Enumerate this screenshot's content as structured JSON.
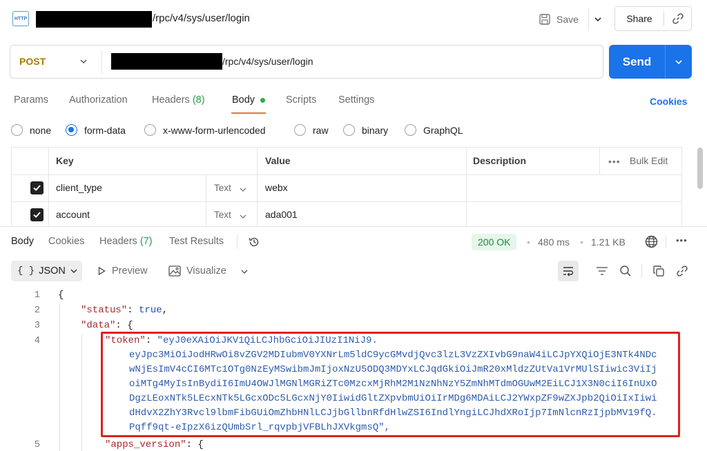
{
  "header": {
    "badge": "HTTP",
    "title_path": "/rpc/v4/sys/user/login",
    "save_label": "Save",
    "share_label": "Share"
  },
  "request": {
    "method": "POST",
    "url_path": "/rpc/v4/sys/user/login",
    "send_label": "Send"
  },
  "tabs": {
    "params": "Params",
    "authorization": "Authorization",
    "headers": "Headers",
    "headers_count": "(8)",
    "body": "Body",
    "scripts": "Scripts",
    "settings": "Settings",
    "cookies": "Cookies"
  },
  "body_types": {
    "none": "none",
    "form_data": "form-data",
    "urlencoded": "x-www-form-urlencoded",
    "raw": "raw",
    "binary": "binary",
    "graphql": "GraphQL",
    "selected": "form-data"
  },
  "table": {
    "headers": {
      "key": "Key",
      "value": "Value",
      "description": "Description",
      "bulk_edit": "Bulk Edit"
    },
    "rows": [
      {
        "key": "client_type",
        "type": "Text",
        "value": "webx",
        "checked": true
      },
      {
        "key": "account",
        "type": "Text",
        "value": "ada001",
        "checked": true
      }
    ]
  },
  "response": {
    "tabs": {
      "body": "Body",
      "cookies": "Cookies",
      "headers": "Headers",
      "headers_count": "(7)",
      "test_results": "Test Results"
    },
    "status": "200 OK",
    "time": "480 ms",
    "size": "1.21 KB",
    "format": "JSON",
    "preview": "Preview",
    "visualize": "Visualize"
  },
  "code": {
    "line_numbers": [
      "1",
      "2",
      "3",
      "4",
      "5"
    ],
    "l1": "{",
    "l2_key": "\"status\"",
    "l2_sep": ": ",
    "l2_val": "true",
    "l2_end": ",",
    "l3_key": "\"data\"",
    "l3_rest": ": {",
    "l4_key": "\"token\"",
    "l4_sep": ": ",
    "token_lines": [
      "\"eyJ0eXAiOiJKV1QiLCJhbGciOiJIUzI1NiJ9.",
      "eyJpc3MiOiJodHRwOi8vZGV2MDIubmV0YXNrLm5ldC9ycGMvdjQvc3lzL3VzZXIvbG9naW4iLCJpYXQiOjE3NTk4NDc",
      "wNjEsImV4cCI6MTc1OTg0NzEyMSwibmJmIjoxNzU5ODQ3MDYxLCJqdGkiOiJmR20xMldzZUtVa1VrMUlSIiwic3ViIj",
      "oiMTg4MyIsInBydiI6ImU4OWJlMGNlMGRiZTc0MzcxMjRhM2M1NzNhNzY5ZmNhMTdmOGUwM2EiLCJ1X3N0ciI6InUxO",
      "DgzLEoxNTk5LEcxNTk5LGcxODc5LGcxNjY0IiwidGltZXpvbmUiOiIrMDg6MDAiLCJ2YWxpZF9wZXJpb2QiOiIxIiwi",
      "dHdvX2ZhY3Rvcl9lbmFibGUiOmZhbHNlLCJjbGllbnRfdHlwZSI6IndlYngiLCJhdXRoIjp7ImNlcnRzIjpbMV19fQ.",
      "Pqff9qt-eIpzX6izQUmbSrl_rqvpbjVFBLhJXVkgmsQ\","
    ],
    "l5_key": "\"apps_version\"",
    "l5_rest": ": {"
  },
  "colors": {
    "accent": "#1a73e8",
    "method": "#a97a00",
    "status_bg": "#e6f6ea",
    "status_fg": "#1e8a3a",
    "highlight_border": "#e02020"
  }
}
